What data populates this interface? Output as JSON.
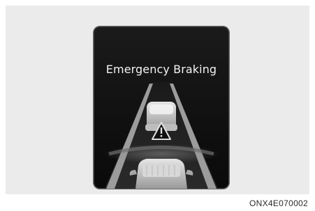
{
  "display": {
    "title": "Emergency Braking",
    "icons": [
      "road-lanes-icon",
      "front-vehicle-icon",
      "warning-triangle-icon",
      "own-vehicle-icon"
    ]
  },
  "figure_code": "ONX4E070002",
  "colors": {
    "background": "#ffffff",
    "panel": "#ebebeb",
    "screen": "#141414",
    "text": "#f2f2f2"
  }
}
